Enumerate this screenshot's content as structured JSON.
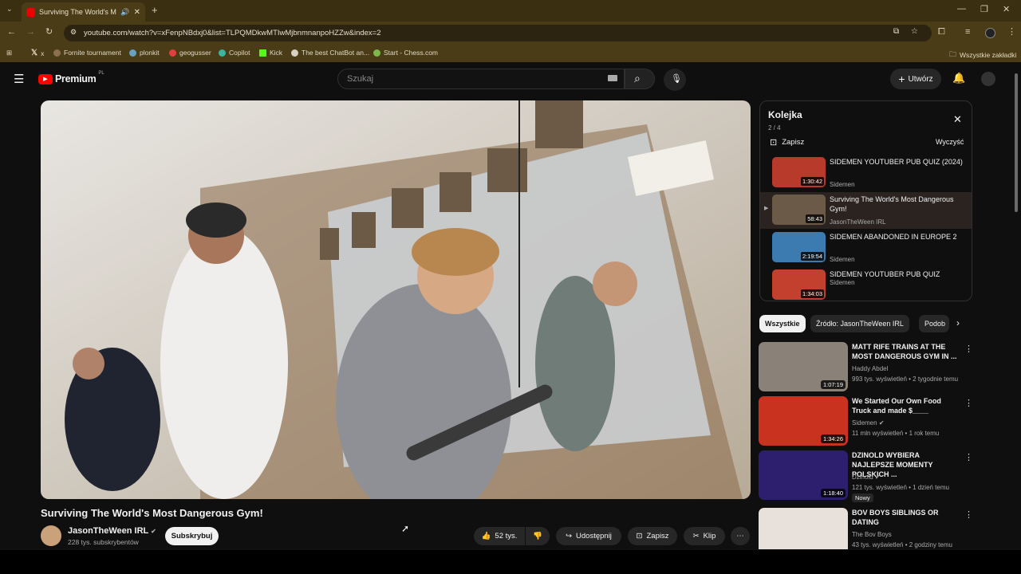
{
  "browser": {
    "tab_title": "Surviving The World's Most",
    "url": "youtube.com/watch?v=xFenpNBdxj0&list=TLPQMDkwMTIwMjbnmnanpoHZZw&index=2",
    "bookmarks": [
      {
        "label": "x",
        "icon": "x-icon"
      },
      {
        "label": "Fornite tournament",
        "icon": "bookmark-icon"
      },
      {
        "label": "plonkit",
        "icon": "bookmark-icon"
      },
      {
        "label": "geogusser",
        "icon": "pin-icon"
      },
      {
        "label": "Copilot",
        "icon": "copilot-icon"
      },
      {
        "label": "Kick",
        "icon": "kick-icon"
      },
      {
        "label": "The best ChatBot an...",
        "icon": "bookmark-icon"
      },
      {
        "label": "Start - Chess.com",
        "icon": "pawn-icon"
      }
    ],
    "all_bookmarks": "Wszystkie zakładki"
  },
  "masthead": {
    "logo": "Premium",
    "logo_badge": "PL",
    "search_placeholder": "Szukaj",
    "create_label": "Utwórz"
  },
  "video": {
    "title": "Surviving The World's Most Dangerous Gym!",
    "channel": "JasonTheWeen IRL",
    "subscribers": "228 tys. subskrybentów",
    "subscribe_label": "Subskrybuj",
    "likes": "52 tys.",
    "share_label": "Udostępnij",
    "save_label": "Zapisz",
    "clip_label": "Klip"
  },
  "queue": {
    "title": "Kolejka",
    "position": "2 / 4",
    "save_label": "Zapisz",
    "clear_label": "Wyczyść",
    "items": [
      {
        "title": "SIDEMEN YOUTUBER PUB QUIZ (2024)",
        "channel": "Sidemen",
        "duration": "1:30:42",
        "color": "#b83a2a"
      },
      {
        "title": "Surviving The World's Most Dangerous Gym!",
        "channel": "JasonTheWeen IRL",
        "duration": "58:43",
        "color": "#6b5a48"
      },
      {
        "title": "SIDEMEN ABANDONED IN EUROPE 2",
        "channel": "Sidemen",
        "duration": "2:19:54",
        "color": "#3c7bb0"
      },
      {
        "title": "SIDEMEN YOUTUBER PUB QUIZ",
        "channel": "Sidemen",
        "duration": "1:34:03",
        "color": "#c2402d"
      }
    ]
  },
  "chips": [
    "Wszystkie",
    "Źródło: JasonTheWeen IRL",
    "Podob"
  ],
  "recommendations": [
    {
      "title": "MATT RIFE TRAINS AT THE MOST DANGEROUS GYM IN ...",
      "channel": "Haddy Abdel",
      "meta": "993 tys. wyświetleń • 2 tygodnie temu",
      "duration": "1:07:19",
      "color": "#8a8278",
      "badge": ""
    },
    {
      "title": "We Started Our Own Food Truck and made $____",
      "channel": "Sidemen",
      "meta": "11 mln wyświetleń • 1 rok temu",
      "duration": "1:34:26",
      "color": "#c9321f",
      "badge": ""
    },
    {
      "title": "DZINOLD WYBIERA NAJLEPSZE MOMENTY POLSKICH ...",
      "channel": "Dzinold",
      "meta": "121 tys. wyświetleń • 1 dzień temu",
      "duration": "1:18:40",
      "color": "#2d1f6e",
      "badge": "Nowy"
    },
    {
      "title": "BOV BOYS SIBLINGS OR DATING",
      "channel": "The Bov Boys",
      "meta": "43 tys. wyświetleń • 2 godziny temu",
      "duration": "",
      "color": "#e8e0da",
      "badge": ""
    }
  ]
}
